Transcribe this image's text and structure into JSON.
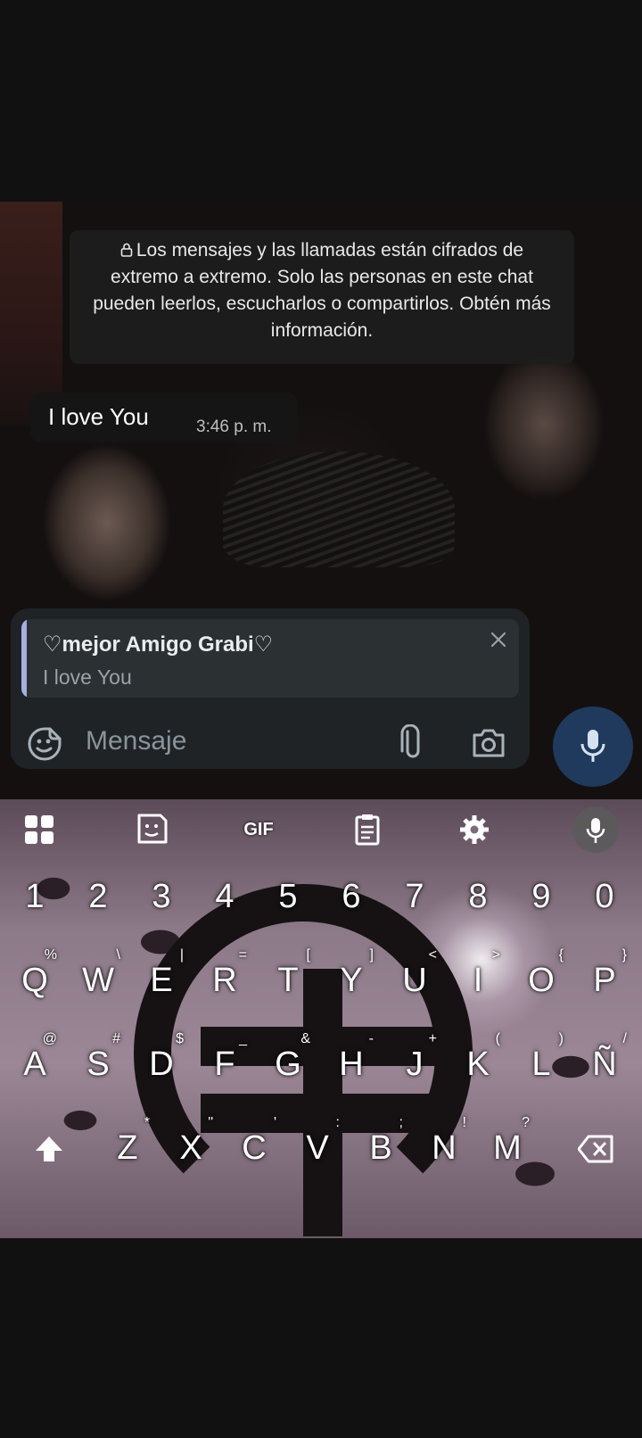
{
  "chat": {
    "encryption_notice": "Los mensajes y las llamadas están cifrados de extremo a extremo. Solo las personas en este chat pueden leerlos, escucharlos o compartirlos. Obtén más información.",
    "messages": [
      {
        "text": "I love You",
        "time": "3:46 p. m."
      }
    ]
  },
  "reply": {
    "name": "♡mejor Amigo Grabi♡",
    "text": "I love You"
  },
  "composer": {
    "placeholder": "Mensaje"
  },
  "keyboard": {
    "toolbar": [
      "apps-grid-icon",
      "sticker-icon",
      "gif-icon",
      "clipboard-icon",
      "settings-icon",
      "mic-icon"
    ],
    "gif_label": "GIF",
    "numbers": [
      "1",
      "2",
      "3",
      "4",
      "5",
      "6",
      "7",
      "8",
      "9",
      "0"
    ],
    "row1": [
      {
        "k": "Q",
        "h": "%"
      },
      {
        "k": "W",
        "h": "\\"
      },
      {
        "k": "E",
        "h": "|"
      },
      {
        "k": "R",
        "h": "="
      },
      {
        "k": "T",
        "h": "["
      },
      {
        "k": "Y",
        "h": "]"
      },
      {
        "k": "U",
        "h": "<"
      },
      {
        "k": "I",
        "h": ">"
      },
      {
        "k": "O",
        "h": "{"
      },
      {
        "k": "P",
        "h": "}"
      }
    ],
    "row2": [
      {
        "k": "A",
        "h": "@"
      },
      {
        "k": "S",
        "h": "#"
      },
      {
        "k": "D",
        "h": "$"
      },
      {
        "k": "F",
        "h": "_"
      },
      {
        "k": "G",
        "h": "&"
      },
      {
        "k": "H",
        "h": "-"
      },
      {
        "k": "J",
        "h": "+"
      },
      {
        "k": "K",
        "h": "("
      },
      {
        "k": "L",
        "h": ")"
      },
      {
        "k": "Ñ",
        "h": "/"
      }
    ],
    "row3": [
      {
        "k": "Z",
        "h": "*"
      },
      {
        "k": "X",
        "h": "\""
      },
      {
        "k": "C",
        "h": "'"
      },
      {
        "k": "V",
        "h": ":"
      },
      {
        "k": "B",
        "h": ";"
      },
      {
        "k": "N",
        "h": "!"
      },
      {
        "k": "M",
        "h": "?"
      }
    ]
  },
  "colors": {
    "accent_mic": "#1f3a5c",
    "quote_bar": "#a4b0e0",
    "panel": "#1f2326"
  }
}
